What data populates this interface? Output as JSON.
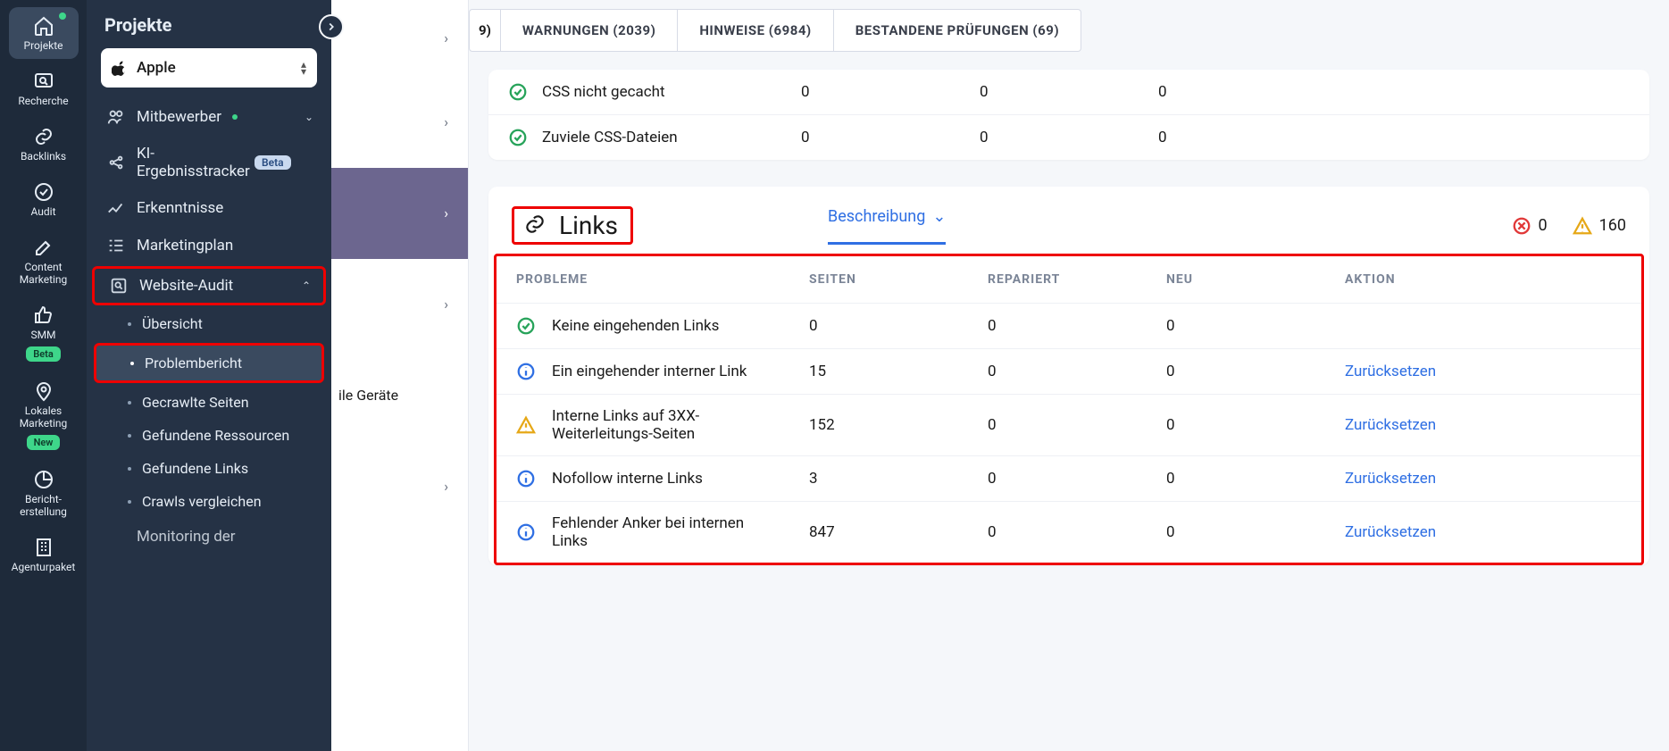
{
  "rail": {
    "items": [
      {
        "label": "Projekte"
      },
      {
        "label": "Recherche"
      },
      {
        "label": "Backlinks"
      },
      {
        "label": "Audit"
      },
      {
        "label": "Content Marketing"
      },
      {
        "label": "SMM",
        "badge": "Beta"
      },
      {
        "label": "Lokales Marketing",
        "badge": "New"
      },
      {
        "label": "Bericht­erstellung"
      },
      {
        "label": "Agenturpaket"
      }
    ]
  },
  "panel": {
    "title": "Projekte",
    "project": "Apple",
    "nav": {
      "mitbewerber": "Mitbewerber",
      "ki": "KI-Ergebnisstracker",
      "ki_badge": "Beta",
      "erkenntnisse": "Erkenntnisse",
      "marketingplan": "Marketingplan",
      "websiteAudit": "Website-Audit",
      "monitoring": "Monitoring der"
    },
    "subs": [
      "Übersicht",
      "Problembericht",
      "Gecrawlte Seiten",
      "Gefundene Ressourcen",
      "Gefundene Links",
      "Crawls vergleichen"
    ]
  },
  "tabs": {
    "trunc": "9)",
    "warn": "WARNUNGEN (2039)",
    "hint": "HINWEISE (6984)",
    "pass": "BESTANDENE PRÜFUNGEN (69)"
  },
  "sliver": {
    "mobile": "ile Geräte"
  },
  "topRows": [
    {
      "name": "CSS nicht gecacht",
      "pages": "0",
      "rep": "0",
      "neu": "0"
    },
    {
      "name": "Zuviele CSS-Dateien",
      "pages": "0",
      "rep": "0",
      "neu": "0"
    }
  ],
  "links": {
    "title": "Links",
    "descTab": "Beschreibung",
    "err": "0",
    "warn": "160",
    "header": {
      "prob": "PROBLEME",
      "pages": "SEITEN",
      "rep": "REPARIERT",
      "neu": "NEU",
      "act": "AKTION"
    },
    "rows": [
      {
        "icon": "check",
        "name": "Keine eingehenden Links",
        "pages": "0",
        "rep": "0",
        "neu": "0",
        "act": ""
      },
      {
        "icon": "info",
        "name": "Ein eingehender interner Link",
        "pages": "15",
        "rep": "0",
        "neu": "0",
        "act": "Zurücksetzen"
      },
      {
        "icon": "warn",
        "name": "Interne Links auf 3XX-Weiterleitungs-Seiten",
        "pages": "152",
        "rep": "0",
        "neu": "0",
        "act": "Zurücksetzen"
      },
      {
        "icon": "info",
        "name": "Nofollow interne Links",
        "pages": "3",
        "rep": "0",
        "neu": "0",
        "act": "Zurücksetzen"
      },
      {
        "icon": "info",
        "name": "Fehlender Anker bei internen Links",
        "pages": "847",
        "rep": "0",
        "neu": "0",
        "act": "Zurücksetzen"
      }
    ]
  }
}
